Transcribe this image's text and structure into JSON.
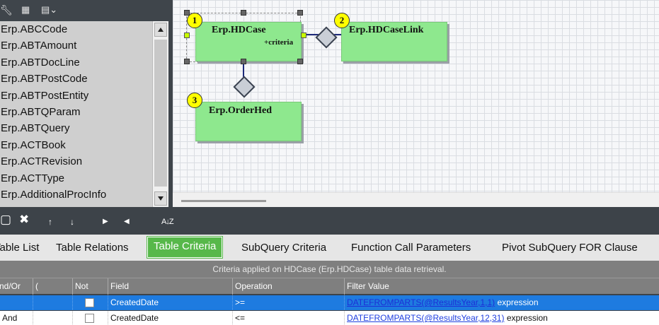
{
  "left_toolbar": {
    "icons": [
      "tool-icon",
      "grid-icon",
      "calculator-dropdown-icon"
    ]
  },
  "table_list": {
    "items": [
      "Erp.ABCCode",
      "Erp.ABTAmount",
      "Erp.ABTDocLine",
      "Erp.ABTPostCode",
      "Erp.ABTPostEntity",
      "Erp.ABTQParam",
      "Erp.ABTQuery",
      "Erp.ACTBook",
      "Erp.ACTRevision",
      "Erp.ACTType",
      "Erp.AdditionalProcInfo"
    ]
  },
  "diagram": {
    "tables": [
      {
        "number": "1",
        "name": "Erp.HDCase",
        "criteria": "+criteria",
        "selected": true
      },
      {
        "number": "2",
        "name": "Erp.HDCaseLink",
        "criteria": "",
        "selected": false
      },
      {
        "number": "3",
        "name": "Erp.OrderHed",
        "criteria": "",
        "selected": false
      }
    ]
  },
  "bottom_toolbar": {
    "icons": [
      "new-icon",
      "delete-icon",
      "move-up-icon",
      "move-down-icon",
      "indent-right-icon",
      "indent-left-icon",
      "sort-icon"
    ],
    "glyphs": {
      "new": "▢",
      "delete": "✖",
      "up": "🡑",
      "down": "🡓",
      "right": "▶",
      "left": "◀",
      "sort": "A↓Z"
    }
  },
  "tabs": {
    "items": [
      {
        "label": "Table List",
        "active": false
      },
      {
        "label": "Table Relations",
        "active": false
      },
      {
        "label": "Table Criteria",
        "active": true
      },
      {
        "label": "SubQuery Criteria",
        "active": false
      },
      {
        "label": "Function Call Parameters",
        "active": false
      },
      {
        "label": "Pivot SubQuery FOR Clause",
        "active": false
      }
    ]
  },
  "criteria_grid": {
    "caption": "Criteria applied on HDCase (Erp.HDCase)  table data retrieval.",
    "columns": [
      "And/Or",
      "(",
      "Not",
      "Field",
      "Operation",
      "Filter Value"
    ],
    "rows": [
      {
        "andor": "",
        "paren": "",
        "not": false,
        "field": "CreatedDate",
        "operation": ">=",
        "filter_link": "DATEFROMPARTS(@ResultsYear,1,1)",
        "filter_type": "expression",
        "selected": true
      },
      {
        "andor": "And",
        "paren": "",
        "not": false,
        "field": "CreatedDate",
        "operation": "<=",
        "filter_link": "DATEFROMPARTS(@ResultsYear,12,31)",
        "filter_type": "expression",
        "selected": false
      }
    ]
  },
  "colors": {
    "active_tab": "#57b84a",
    "table_box": "#8ee88e",
    "selected_row": "#1e7be0",
    "badge": "#ffff00"
  }
}
